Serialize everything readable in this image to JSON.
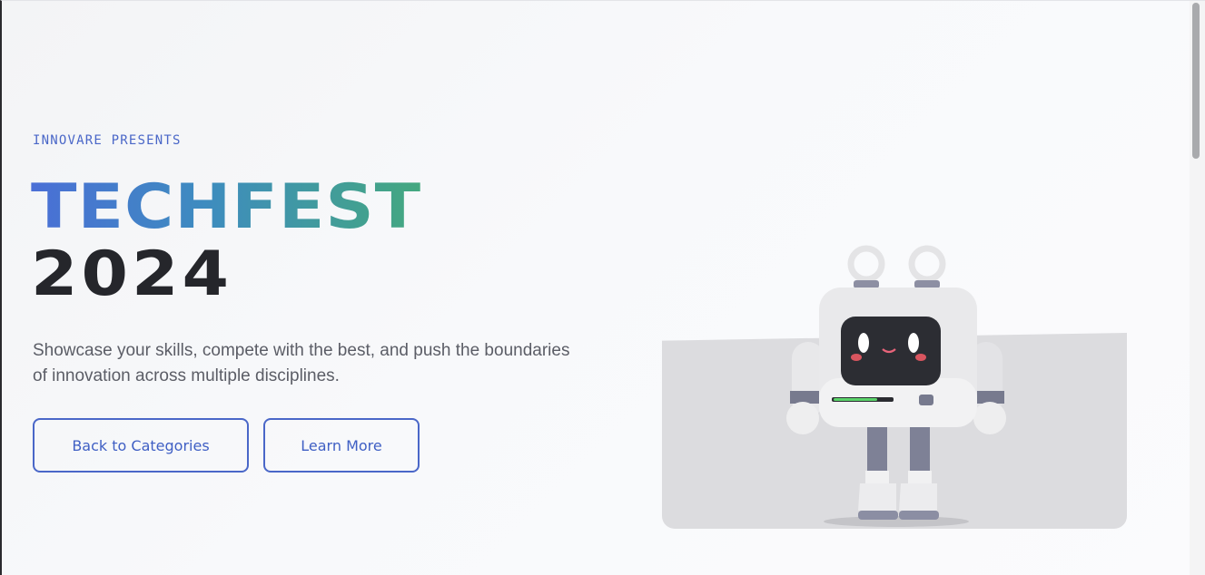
{
  "hero": {
    "eyebrow": "INNOVARE PRESENTS",
    "title_line1": "TECHFEST",
    "title_line2": "2024",
    "description": "Showcase your skills, compete with the best, and push the boundaries of innovation across multiple disciplines."
  },
  "actions": {
    "back_label": "Back to Categories",
    "learn_label": "Learn More"
  },
  "illustration": {
    "icon": "robot-mascot-icon"
  },
  "colors": {
    "accent": "#4a67c8",
    "title_gradient_start": "#4a6fd6",
    "title_gradient_end": "#44a87f",
    "title_dark": "#25262b"
  }
}
